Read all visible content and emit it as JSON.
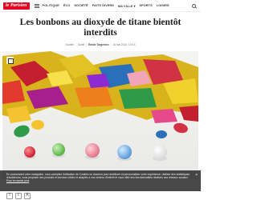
{
  "nav": {
    "logo": "le Parisien",
    "items": [
      "POLITIQUE",
      "ÉCO",
      "SOCIÉTÉ",
      "FAITS DIVERS",
      "MA VILLE ▾",
      "SPORTS",
      "LOISIRS"
    ]
  },
  "article": {
    "headline": "Les bonbons au dioxyde de titane bientôt interdits",
    "meta": {
      "section": "Société",
      "subsection": "Santé",
      "author": "Émilie Torgemen",
      "date": "16 mai 2016, 17h14"
    }
  },
  "cookie_banner": {
    "text": "En poursuivant votre navigation, vous acceptez l'utilisation de Cookies ou traceurs pour améliorer et personnaliser votre expérience, réaliser des statistiques d'audiences, vous proposer des produits et services ciblés et adaptés à vos centres d'intérêt et vous offrir des fonctionnalités relatives aux réseaux sociaux.",
    "link": "Pour en savoir plus",
    "close": "×"
  },
  "share": {
    "buttons": [
      "f",
      "t",
      "A"
    ]
  }
}
